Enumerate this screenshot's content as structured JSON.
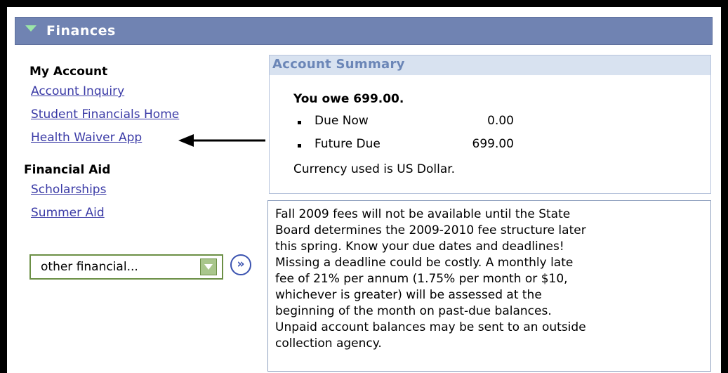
{
  "colors": {
    "header_bg": "#7083b2",
    "link": "#3a3aa6",
    "summary_header_bg": "#d8e2f0",
    "summary_title": "#6b86b7"
  },
  "header": {
    "title": "Finances",
    "icon": "expand-triangle-icon"
  },
  "sidebar": {
    "my_account": {
      "heading": "My Account",
      "links": [
        "Account Inquiry",
        "Student Financials Home",
        "Health Waiver App"
      ]
    },
    "financial_aid": {
      "heading": "Financial Aid",
      "links": [
        "Scholarships",
        "Summer Aid"
      ]
    },
    "dropdown": {
      "selected": "other financial...",
      "icon": "dropdown-arrow-icon"
    },
    "go_button": {
      "label": "»",
      "icon": "double-chevron-right-icon"
    }
  },
  "annotation": {
    "icon": "pointer-arrow-icon"
  },
  "summary": {
    "title": "Account Summary",
    "owe_text": "You owe 699.00.",
    "items": [
      {
        "label": "Due Now",
        "value": "0.00"
      },
      {
        "label": "Future Due",
        "value": "699.00"
      }
    ],
    "currency_text": "Currency used is US Dollar."
  },
  "notice": {
    "text": "Fall 2009 fees will not be available until the State\nBoard determines the 2009-2010 fee structure later\nthis spring. Know your due dates and deadlines!\nMissing a deadline could be costly. A monthly late\nfee of 21% per annum (1.75% per month or $10,\nwhichever is greater) will be assessed at the\nbeginning of the month on past-due balances.\nUnpaid account balances may be sent to an outside\ncollection agency."
  }
}
